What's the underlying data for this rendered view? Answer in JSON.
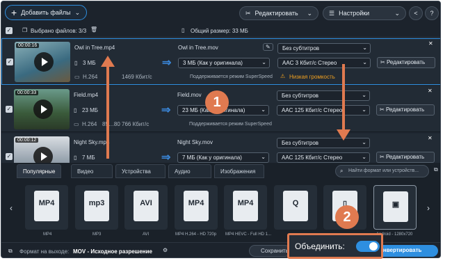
{
  "topbar": {
    "add_files": "Добавить файлы",
    "edit": "Редактировать",
    "settings": "Настройки"
  },
  "selbar": {
    "selected": "Выбрано файлов: 3/3",
    "total": "Общий размер: 33 МБ"
  },
  "files": [
    {
      "duration": "00:00:16",
      "name": "Owl in Tree.mp4",
      "size": "3 МБ",
      "codec": "H.264",
      "bitrate": "1469 Кбит/с",
      "out_name": "Owl in Tree.mov",
      "out_size": "3 МБ (Как у оригинала)",
      "subs": "Без субтитров",
      "audio": "AAC 3 Кбит/с Стерео",
      "supports": "Поддерживается режим SuperSpeed",
      "warn": "Низкая громкость",
      "edit": "Редактировать"
    },
    {
      "duration": "00:00:33",
      "name": "Field.mp4",
      "size": "23 МБ",
      "codec": "H.264",
      "bitrate": "85…80 766 Кбит/с",
      "out_name": "Field.mov",
      "out_size": "23 МБ (Как у оригинала)",
      "subs": "Без субтитров",
      "audio": "AAC 125 Кбит/с Стерео",
      "supports": "Поддерживается режим SuperSpeed",
      "edit": "Редактировать"
    },
    {
      "duration": "00:00:12",
      "name": "Night Sky.mp4",
      "size": "7 МБ",
      "out_name": "Night Sky.mov",
      "out_size": "7 МБ (Как у оригинала)",
      "subs": "Без субтитров",
      "audio": "AAC 125 Кбит/с Стерео",
      "edit": "Редактировать"
    }
  ],
  "tabs": [
    "Популярные",
    "Видео",
    "Устройства",
    "Аудио",
    "Изображения"
  ],
  "search_placeholder": "Найти формат или устройств...",
  "formats": [
    {
      "icon": "MP4",
      "label": "MP4"
    },
    {
      "icon": "mp3",
      "label": "MP3"
    },
    {
      "icon": "AVI",
      "label": "AVI"
    },
    {
      "icon": "MP4",
      "label": "MP4 H.264 - HD 720p"
    },
    {
      "icon": "MP4",
      "label": "MP4 HEVC - Full HD 1..."
    },
    {
      "icon": "Q",
      "label": "..."
    },
    {
      "icon": "▯",
      "label": ""
    },
    {
      "icon": "▣",
      "label": "Android - 1280x720"
    }
  ],
  "bottom": {
    "format_label": "Формат на выходе:",
    "format_value": "MOV - Исходное разрешение",
    "save": "Сохранить",
    "merge": "Объединить:",
    "convert": "онвертировать"
  },
  "callouts": [
    "1",
    "2"
  ],
  "colors": {
    "accent": "#2e8fe0",
    "callout": "#e07a50",
    "warn": "#f0a020"
  }
}
